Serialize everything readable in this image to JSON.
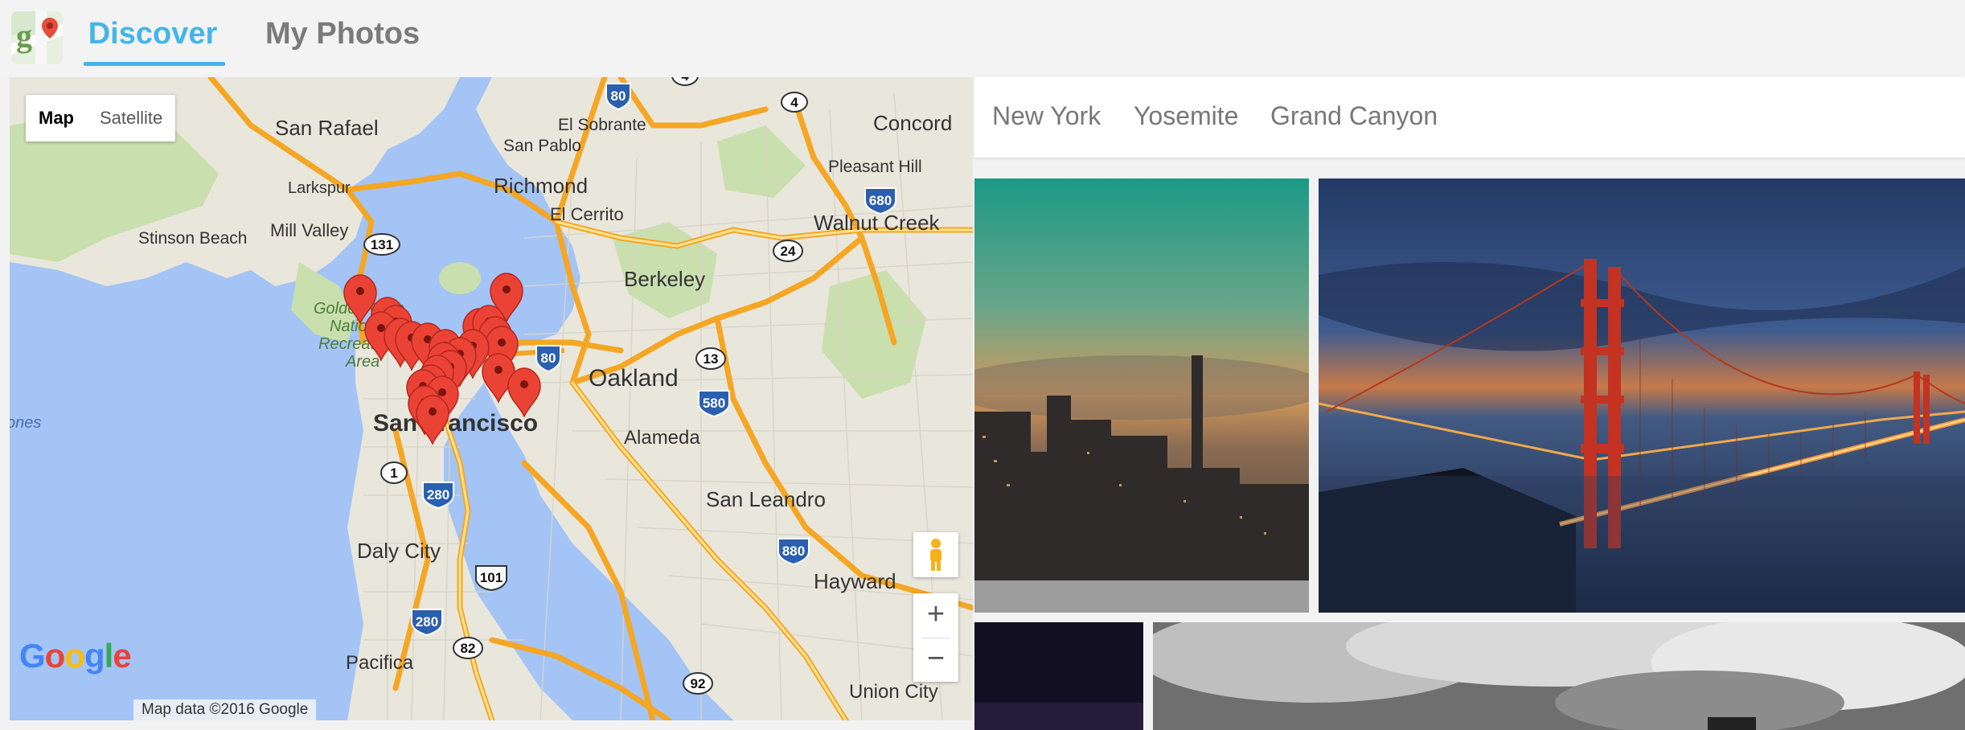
{
  "app": {
    "tabs": [
      {
        "label": "Discover",
        "active": true
      },
      {
        "label": "My Photos",
        "active": false
      }
    ],
    "accent_color": "#44b5ea"
  },
  "map": {
    "type_controls": [
      "Map",
      "Satellite"
    ],
    "active_type": "Map",
    "zoom_in": "+",
    "zoom_out": "−",
    "logo": "Google",
    "attribution": "Map data ©2016 Google",
    "labels": {
      "san_rafael": "San Rafael",
      "el_sobrante": "El Sobrante",
      "san_pablo": "San Pablo",
      "concord": "Concord",
      "pleasant_hill": "Pleasant Hill",
      "larkspur": "Larkspur",
      "richmond": "Richmond",
      "el_cerrito": "El Cerrito",
      "stinson_beach": "Stinson Beach",
      "mill_valley": "Mill Valley",
      "walnut_creek": "Walnut Creek",
      "berkeley": "Berkeley",
      "golden_gate": "Golden Gate",
      "national": "National",
      "recreation": "Recreation",
      "area": "Area",
      "oakland": "Oakland",
      "san_francisco": "San Francisco",
      "alameda": "Alameda",
      "san_leandro": "San Leandro",
      "daly_city": "Daly City",
      "hayward": "Hayward",
      "pacifica": "Pacifica",
      "union_city": "Union City",
      "jones": "ones"
    },
    "shields": {
      "i80_a": "80",
      "r4a": "4",
      "r4b": "4",
      "i680": "680",
      "r131": "131",
      "r24": "24",
      "i80_b": "80",
      "r13": "13",
      "i580": "580",
      "r1": "1",
      "i280_a": "280",
      "r101": "101",
      "i880": "880",
      "i280_b": "280",
      "r82": "82",
      "r92": "92"
    },
    "marker_count": 25
  },
  "filters": [
    "New York",
    "Yosemite",
    "Grand Canyon"
  ],
  "photos": [
    {
      "subject": "city-fog-sunset"
    },
    {
      "subject": "golden-gate-bridge-dusk"
    },
    {
      "subject": "night-sky"
    },
    {
      "subject": "bw-clouds"
    }
  ]
}
